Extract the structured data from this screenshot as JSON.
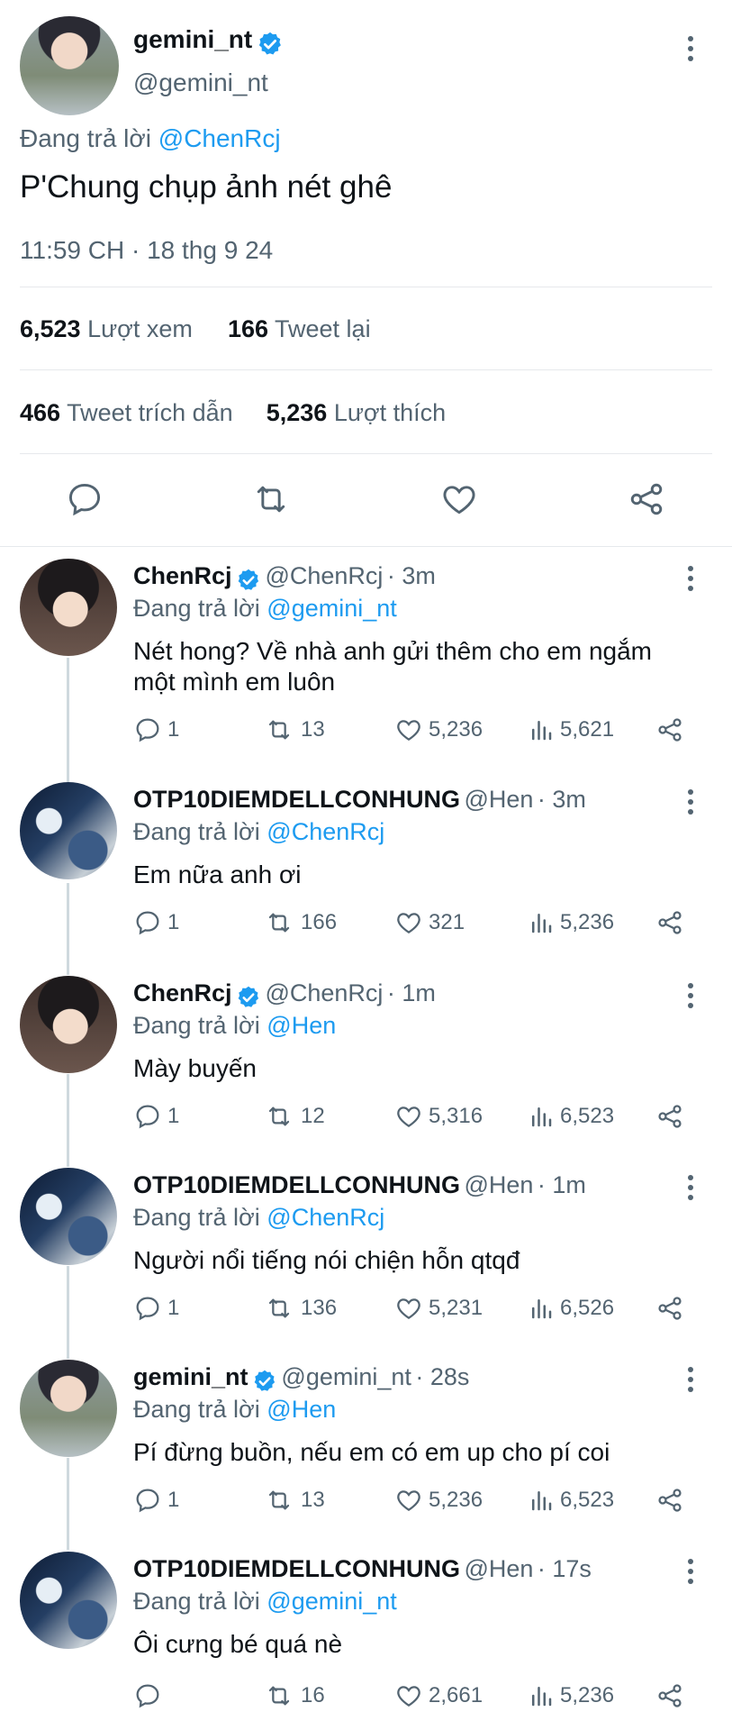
{
  "main_tweet": {
    "name": "gemini_nt",
    "handle": "@gemini_nt",
    "reply_prefix": "Đang trả lời",
    "reply_to": "@ChenRcj",
    "text": "P'Chung chụp ảnh nét ghê",
    "timestamp": "11:59 CH · 18 thg 9 24",
    "stats": {
      "views_num": "6,523",
      "views_label": "Lượt xem",
      "retweets_num": "166",
      "retweets_label": "Tweet lại",
      "quotes_num": "466",
      "quotes_label": "Tweet trích dẫn",
      "likes_num": "5,236",
      "likes_label": "Lượt thích"
    }
  },
  "replies": [
    {
      "name": "ChenRcj",
      "verified": true,
      "handle": "@ChenRcj",
      "time": "· 3m",
      "reply_prefix": "Đang trả lời",
      "reply_to": "@gemini_nt",
      "text_line1": "Nét hong? Về nhà anh gửi thêm cho em ngắm",
      "text_line2": "một mình em luôn",
      "replies": "1",
      "retweets": "13",
      "likes": "5,236",
      "views": "5,621"
    },
    {
      "name": "OTP10DIEMDELLCONHUNG",
      "verified": false,
      "handle": "@Hen",
      "time": "· 3m",
      "reply_prefix": "Đang trả lời",
      "reply_to": "@ChenRcj",
      "text_line1": "Em nữa anh ơi",
      "text_line2": "",
      "replies": "1",
      "retweets": "166",
      "likes": "321",
      "views": "5,236"
    },
    {
      "name": "ChenRcj",
      "verified": true,
      "handle": "@ChenRcj",
      "time": "· 1m",
      "reply_prefix": "Đang trả lời",
      "reply_to": "@Hen",
      "text_line1": "Mày buyến",
      "text_line2": "",
      "replies": "1",
      "retweets": "12",
      "likes": "5,316",
      "views": "6,523"
    },
    {
      "name": "OTP10DIEMDELLCONHUNG",
      "verified": false,
      "handle": "@Hen",
      "time": "· 1m",
      "reply_prefix": "Đang trả lời",
      "reply_to": "@ChenRcj",
      "text_line1": "Người nổi tiếng nói chiện hỗn qtqđ",
      "text_line2": "",
      "replies": "1",
      "retweets": "136",
      "likes": "5,231",
      "views": "6,526"
    },
    {
      "name": "gemini_nt",
      "verified": true,
      "handle": "@gemini_nt",
      "time": "· 28s",
      "reply_prefix": "Đang trả lời",
      "reply_to": "@Hen",
      "text_line1": "Pí đừng buồn, nếu em có em up cho pí coi",
      "text_line2": "",
      "replies": "1",
      "retweets": "13",
      "likes": "5,236",
      "views": "6,523"
    },
    {
      "name": "OTP10DIEMDELLCONHUNG",
      "verified": false,
      "handle": "@Hen",
      "time": "· 17s",
      "reply_prefix": "Đang trả lời",
      "reply_to": "@gemini_nt",
      "text_line1": "Ôi cưng bé quá nè",
      "text_line2": "",
      "replies": "",
      "retweets": "16",
      "likes": "2,661",
      "views": "5,236"
    }
  ],
  "colors": {
    "accent": "#1d9bf0",
    "text": "#0f1419",
    "muted": "#536471",
    "divider": "#e6e9ec"
  }
}
